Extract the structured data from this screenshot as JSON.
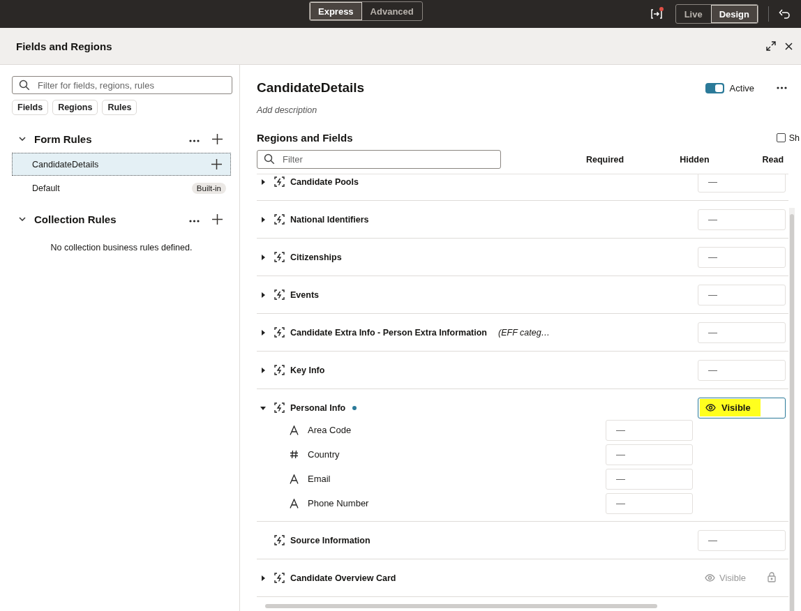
{
  "top_bar": {
    "modes": [
      {
        "label": "Express",
        "selected": true
      },
      {
        "label": "Advanced",
        "selected": false
      }
    ],
    "views": [
      {
        "label": "Live",
        "selected": false
      },
      {
        "label": "Design",
        "selected": true
      }
    ],
    "notification": true
  },
  "panel": {
    "title": "Fields and Regions"
  },
  "sidebar": {
    "search": {
      "placeholder": "Filter for fields, regions, rules"
    },
    "chips": [
      {
        "label": "Fields",
        "selected": false
      },
      {
        "label": "Regions",
        "selected": false
      },
      {
        "label": "Rules",
        "selected": false
      }
    ],
    "sections": [
      {
        "title": "Form Rules",
        "expanded": true,
        "items": [
          {
            "label": "CandidateDetails",
            "selected": true
          },
          {
            "label": "Default",
            "selected": false,
            "badge": "Built-in"
          }
        ]
      },
      {
        "title": "Collection Rules",
        "expanded": true,
        "empty_text": "No collection business rules defined."
      }
    ]
  },
  "editor": {
    "title": "CandidateDetails",
    "description_placeholder": "Add description",
    "active": {
      "label": "Active",
      "on": true
    },
    "regions_title": "Regions and Fields",
    "show_checkbox": {
      "label": "Sh",
      "checked": false
    },
    "filter": {
      "placeholder": "Filter"
    },
    "columns": [
      "Required",
      "Hidden",
      "Read"
    ],
    "regions": [
      {
        "name": "Candidate Pools",
        "caret": true,
        "expanded": false,
        "hidden": {
          "value": "—",
          "disabled": false
        }
      },
      {
        "name": "National Identifiers",
        "caret": true,
        "expanded": false,
        "hidden": {
          "value": "—",
          "disabled": false
        }
      },
      {
        "name": "Citizenships",
        "caret": true,
        "expanded": false,
        "hidden": {
          "value": "—",
          "disabled": false
        }
      },
      {
        "name": "Events",
        "caret": true,
        "expanded": false,
        "hidden": {
          "value": "—",
          "disabled": false
        }
      },
      {
        "name": "Candidate Extra Info - Person Extra Information",
        "note": "(EFF categ…",
        "caret": true,
        "expanded": false,
        "hidden": {
          "value": "—",
          "disabled": false
        }
      },
      {
        "name": "Key Info",
        "caret": true,
        "expanded": false,
        "hidden": {
          "value": "—",
          "disabled": false
        }
      },
      {
        "name": "Personal Info",
        "caret": true,
        "expanded": true,
        "color": "#2b7a99",
        "hidden": {
          "kind": "visible",
          "value": "Visible",
          "disabled": false,
          "highlighted": true
        },
        "children": [
          {
            "name": "Area Code",
            "kind": "text",
            "required": "—"
          },
          {
            "name": "Country",
            "kind": "number",
            "required": "—"
          },
          {
            "name": "Email",
            "kind": "text",
            "required": "—"
          },
          {
            "name": "Phone Number",
            "kind": "text",
            "required": "—"
          }
        ]
      },
      {
        "name": "Source Information",
        "caret": false,
        "hidden": {
          "value": "—",
          "disabled": false
        }
      },
      {
        "name": "Candidate Overview Card",
        "caret": true,
        "expanded": false,
        "hidden": {
          "kind": "visible",
          "value": "Visible",
          "disabled": true
        }
      }
    ]
  }
}
